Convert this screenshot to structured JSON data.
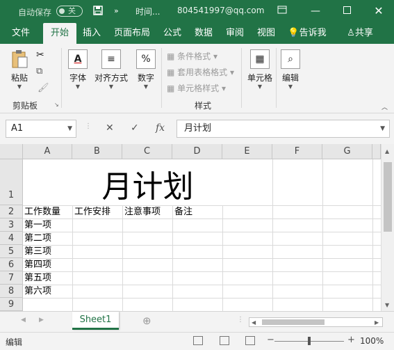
{
  "titlebar": {
    "autosave_label": "自动保存",
    "autosave_state": "关",
    "save_icon": "save-icon",
    "more_icon": "chevron-right-double-icon",
    "doc_name": "时间...",
    "account": "804541997@qq.com",
    "accent": "#217346"
  },
  "tabs": [
    {
      "label": "文件"
    },
    {
      "label": "开始"
    },
    {
      "label": "插入"
    },
    {
      "label": "页面布局"
    },
    {
      "label": "公式"
    },
    {
      "label": "数据"
    },
    {
      "label": "审阅"
    },
    {
      "label": "视图"
    },
    {
      "label": "告诉我"
    },
    {
      "label": "共享"
    }
  ],
  "ribbon": {
    "paste_label": "粘贴",
    "clipboard_group": "剪贴板",
    "font_label": "字体",
    "align_label": "对齐方式",
    "number_label": "数字",
    "cond_format": "条件格式",
    "table_format": "套用表格格式",
    "cell_style": "单元格样式",
    "style_group": "样式",
    "cells_label": "单元格",
    "edit_label": "编辑"
  },
  "formula_bar": {
    "name_box": "A1",
    "fx": "fx",
    "value": "月计划"
  },
  "columns": [
    "A",
    "B",
    "C",
    "D",
    "E",
    "F",
    "G"
  ],
  "rows": [
    "1",
    "2",
    "3",
    "4",
    "5",
    "6",
    "7",
    "8",
    "9"
  ],
  "cells": {
    "title": "月计划",
    "a2": "工作数量",
    "b2": "工作安排",
    "c2": "注意事项",
    "d2": "备注",
    "a3": "第一项",
    "a4": "第二项",
    "a5": "第三项",
    "a6": "第四项",
    "a7": "第五项",
    "a8": "第六项"
  },
  "sheet_tabs": [
    {
      "label": "Sheet1"
    }
  ],
  "status": {
    "mode": "编辑",
    "zoom": "100%"
  }
}
